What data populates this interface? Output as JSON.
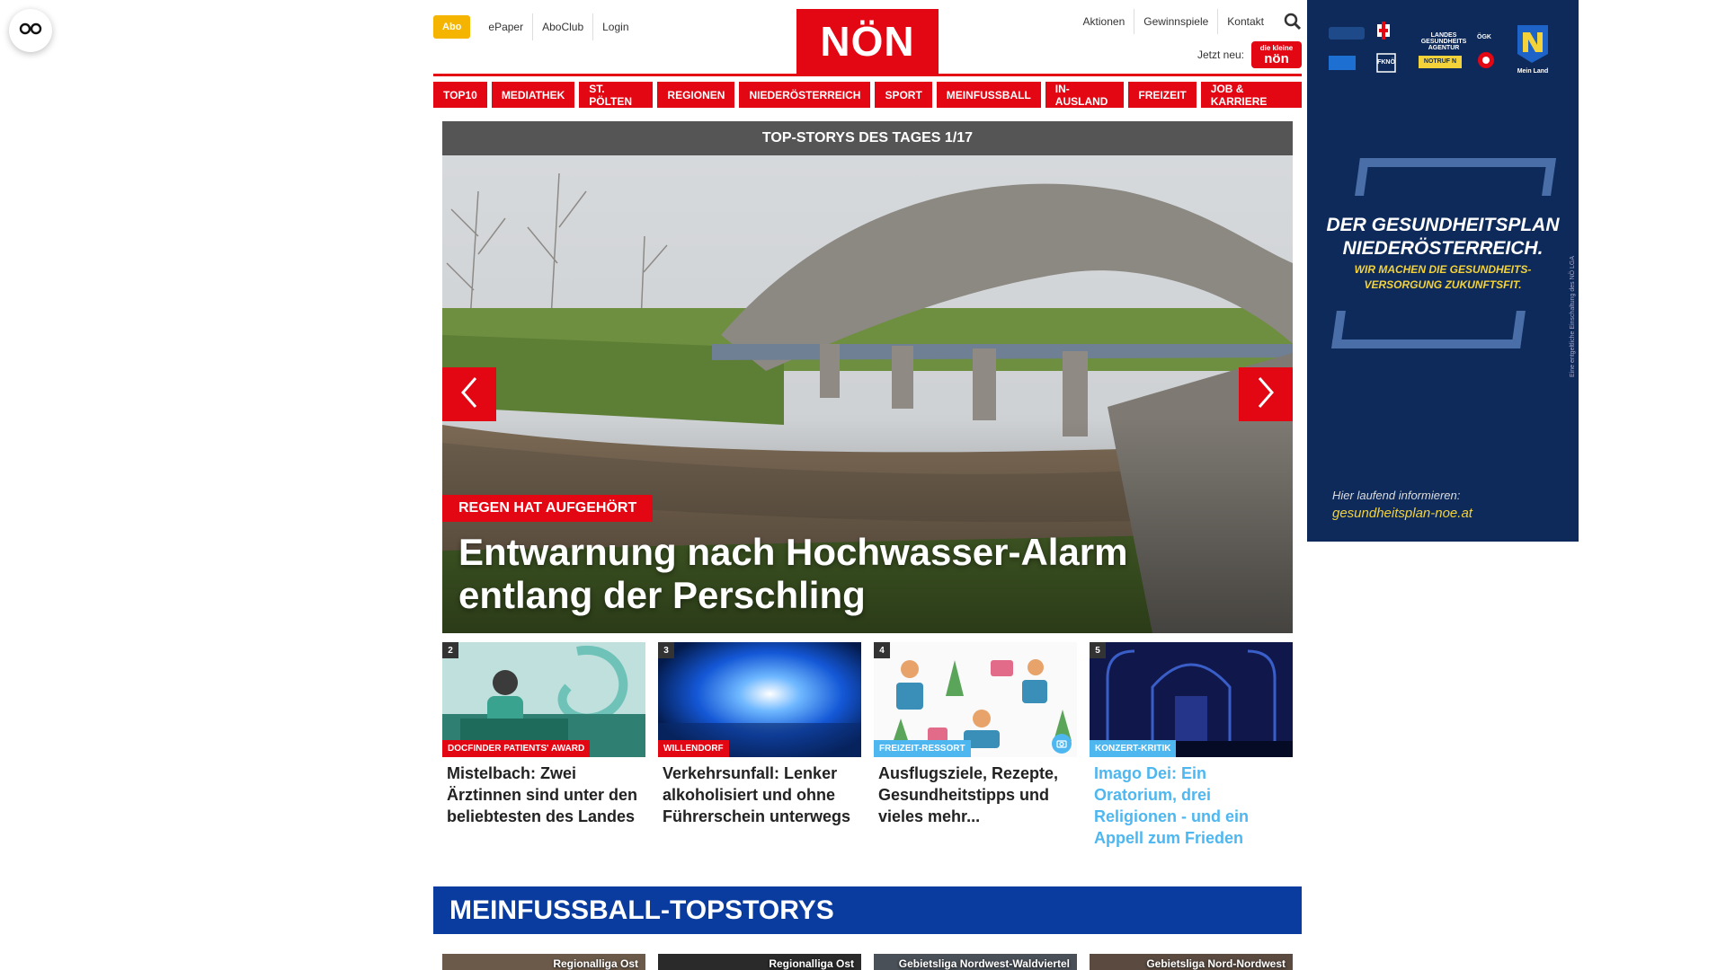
{
  "header": {
    "abo_label": "Abo",
    "meta_links": [
      "ePaper",
      "AboClub",
      "Login"
    ],
    "logo_text": "NÖN",
    "right_links": [
      "Aktionen",
      "Gewinnspiele",
      "Kontakt"
    ],
    "jetzt_label": "Jetzt neu:",
    "jetzt_badge_small": "die kleine",
    "jetzt_badge_big": "nön",
    "search_icon": "search-icon",
    "brand_color": "#e30613"
  },
  "nav": {
    "items": [
      "TOP10",
      "MEDIATHEK",
      "ST. PÖLTEN",
      "REGIONEN",
      "NIEDERÖSTERREICH",
      "SPORT",
      "MEINFUSSBALL",
      "IN-AUSLAND",
      "FREIZEIT",
      "JOB & KARRIERE"
    ]
  },
  "carousel": {
    "heading": "TOP-STORYS DES TAGES 1/17",
    "kicker": "REGEN HAT AUFGEHÖRT",
    "title": "Entwarnung nach Hochwasser-Alarm entlang der Perschling"
  },
  "cards": [
    {
      "num": "2",
      "tag": "DOCFINDER PATIENTS' AWARD",
      "title": "Mistelbach: Zwei Ärztinnen sind unter den beliebtesten des Landes",
      "tag_color": "#e30613"
    },
    {
      "num": "3",
      "tag": "WILLENDORF",
      "title": "Verkehrsunfall: Lenker alkoholisiert und ohne Führerschein unterwegs",
      "tag_color": "#e30613"
    },
    {
      "num": "4",
      "tag": "FREIZEIT-RESSORT",
      "title": "Ausflugsziele, Rezepte, Gesundheitstipps und vieles mehr...",
      "tag_color": "#4eb7f0"
    },
    {
      "num": "5",
      "tag": "KONZERT-KRITIK",
      "title": "Imago Dei: Ein Oratorium, drei Religionen - und ein Appell zum Frieden",
      "tag_color": "#4eb7f0"
    }
  ],
  "fussball": {
    "heading": "MEINFUSSBALL-TOPSTORYS",
    "section_color": "#0a3ca0",
    "labels": [
      "Regionalliga Ost",
      "Regionalliga Ost",
      "Gebietsliga Nordwest-Waldviertel",
      "Gebietsliga Nord-Nordwest"
    ]
  },
  "ad": {
    "headline_1": "DER GESUNDHEITSPLAN",
    "headline_2": "NIEDERÖSTERREICH.",
    "sub_1": "WIR MACHEN DIE GESUNDHEITS-",
    "sub_2": "VERSORGUNG ZUKUNFTSFIT.",
    "info": "Hier laufend informieren:",
    "url": "gesundheitsplan-noe.at",
    "vertical_note": "Eine entgeltliche Einschaltung des NÖ LGA",
    "logos": [
      "LANDES GESUNDHEITS AGENTUR",
      "ÖGK",
      "FKNÖ",
      "NOTRUF N",
      "Mein Land"
    ]
  }
}
